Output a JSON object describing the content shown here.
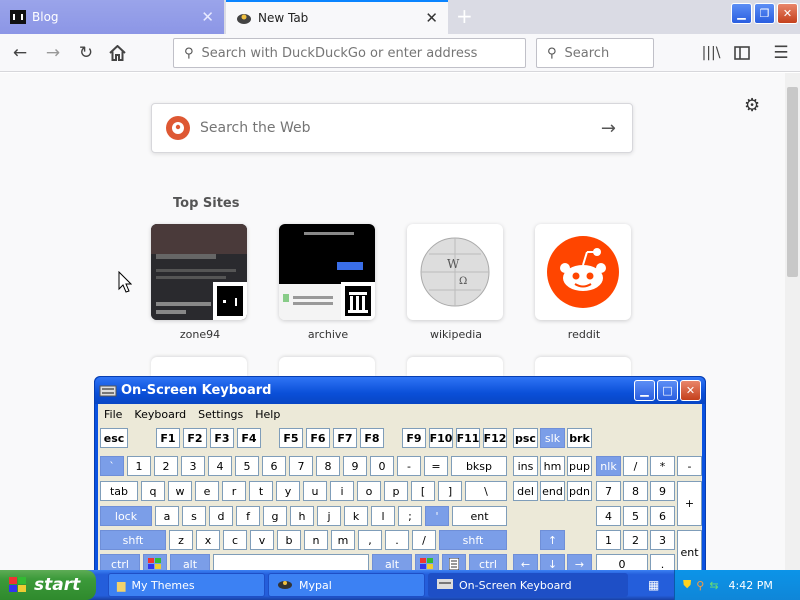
{
  "browser": {
    "tabs": [
      {
        "label": "Blog"
      },
      {
        "label": "New Tab"
      }
    ],
    "url_placeholder": "Search with DuckDuckGo or enter address",
    "search_placeholder": "Search"
  },
  "page": {
    "web_search_placeholder": "Search the Web",
    "top_sites_title": "Top Sites",
    "sites": [
      {
        "label": "zone94"
      },
      {
        "label": "archive"
      },
      {
        "label": "wikipedia"
      },
      {
        "label": "reddit"
      }
    ]
  },
  "osk": {
    "title": "On-Screen Keyboard",
    "menu": [
      "File",
      "Keyboard",
      "Settings",
      "Help"
    ]
  },
  "taskbar": {
    "start": "start",
    "tasks": [
      "My Themes",
      "Mypal",
      "On-Screen Keyboard"
    ],
    "clock": "4:42 PM"
  },
  "colors": {
    "tab_accent": "#0a84ff",
    "xp_title": "#0a52e0",
    "reddit": "#ff4500",
    "duckduckgo": "#de5833"
  }
}
